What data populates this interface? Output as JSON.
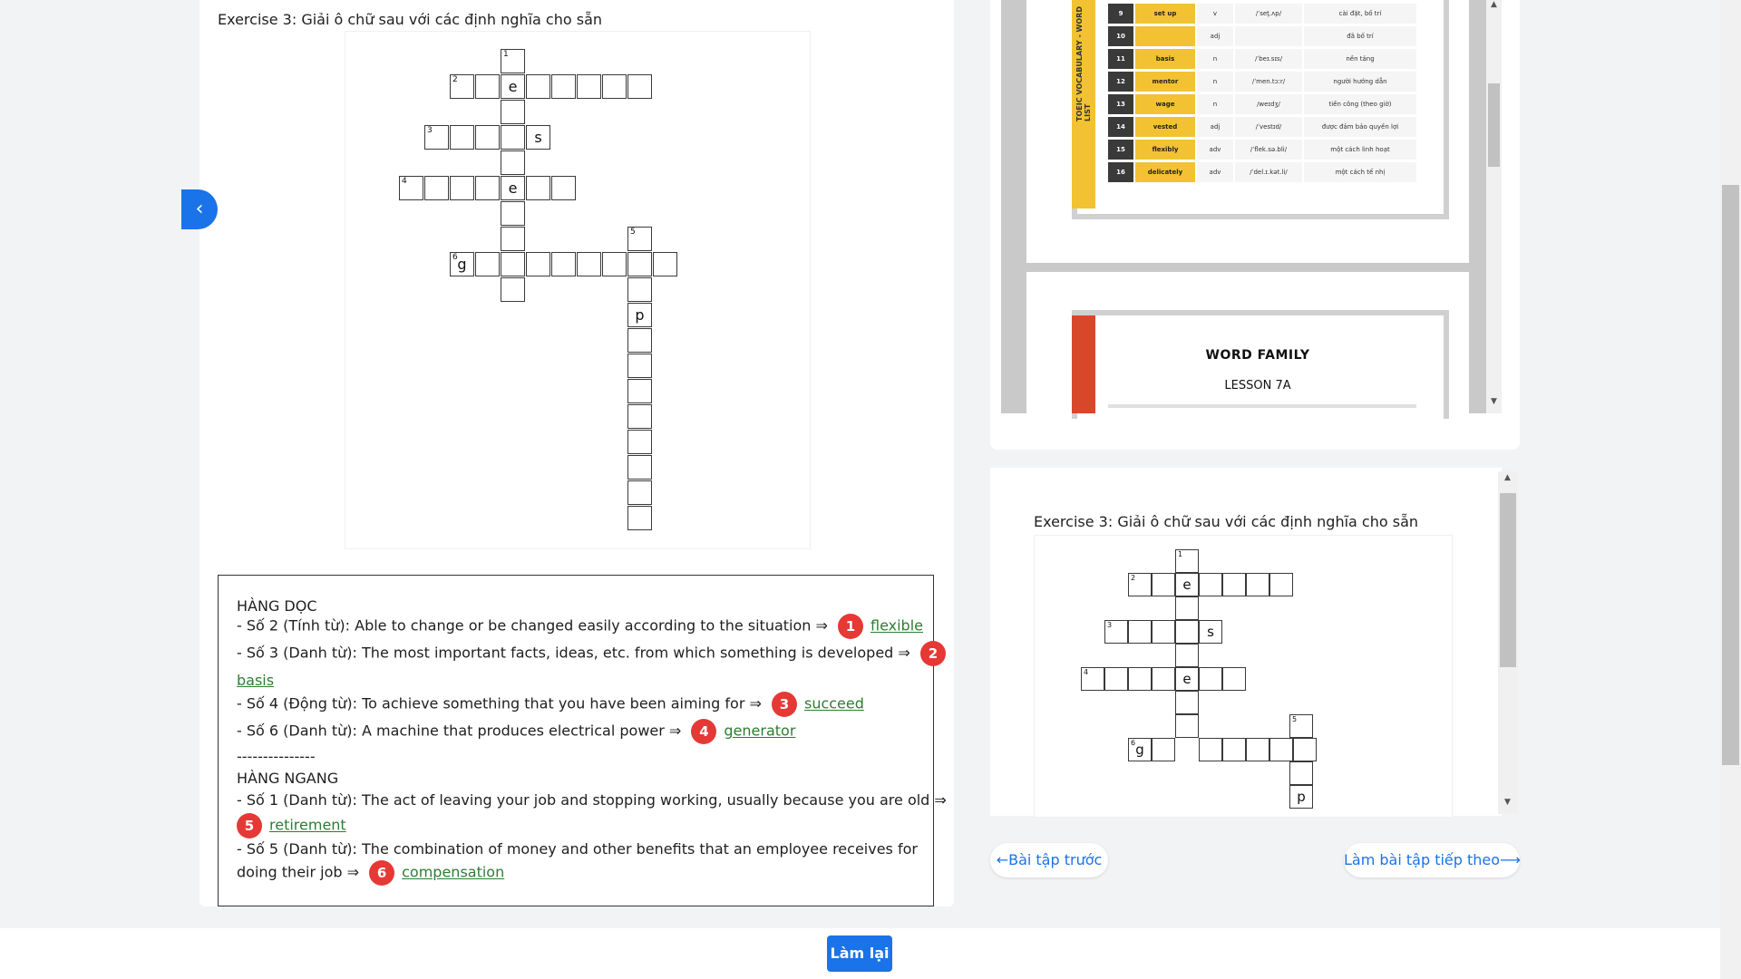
{
  "exercise": {
    "title": "Exercise 3: Giải ô chữ sau với các định nghĩa cho sẵn"
  },
  "crossword": {
    "letters": {
      "l1": "e",
      "l2": "s",
      "l3": "e",
      "l4": "g",
      "l5": "p"
    },
    "numbers": {
      "n1": "1",
      "n2": "2",
      "n3": "3",
      "n4": "4",
      "n5": "5",
      "n6": "6"
    }
  },
  "clues": {
    "vertical_heading": "HÀNG DỌC",
    "v1_text": "- Số 2 (Tính từ): Able to change or be changed easily according to the situation ⇒",
    "v1_badge": "1",
    "v1_answer": "flexible",
    "v2_text": "- Số 3 (Danh từ): The most important facts, ideas, etc. from which something is developed ⇒",
    "v2_badge": "2",
    "v2_answer": "basis",
    "v3_text": "- Số 4 (Động từ): To achieve something that you have been aiming for ⇒",
    "v3_badge": "3",
    "v3_answer": "succeed",
    "v4_text": "- Số 6 (Danh từ): A machine that produces electrical power ⇒",
    "v4_badge": "4",
    "v4_answer": "generator",
    "divider": "---------------",
    "horizontal_heading": "HÀNG NGANG",
    "h1_text": "- Số 1 (Danh từ): The act of leaving your job and stopping working, usually because you are old ⇒",
    "h1_badge": "5",
    "h1_answer": "retirement",
    "h2_text": "- Số 5 (Danh từ): The combination of money and other benefits that an employee receives for",
    "h2_text2": "doing their job ⇒",
    "h2_badge": "6",
    "h2_answer": "compensation"
  },
  "vocab": {
    "side_title": "TOEIC VOCABULARY - WORD LIST",
    "rows": [
      {
        "n": "9",
        "w": "set up",
        "t": "v",
        "p": "/ˈset̬.ʌp/",
        "m": "cài đặt, bố trí"
      },
      {
        "n": "10",
        "w": "",
        "t": "adj",
        "p": "",
        "m": "đã bố trí"
      },
      {
        "n": "11",
        "w": "basis",
        "t": "n",
        "p": "/ˈbeɪ.sɪs/",
        "m": "nền tảng"
      },
      {
        "n": "12",
        "w": "mentor",
        "t": "n",
        "p": "/ˈmen.tɔːr/",
        "m": "người hướng dẫn"
      },
      {
        "n": "13",
        "w": "wage",
        "t": "n",
        "p": "/weɪdʒ/",
        "m": "tiền công (theo giờ)"
      },
      {
        "n": "14",
        "w": "vested",
        "t": "adj",
        "p": "/ˈvestɪd/",
        "m": "được đảm bảo quyền lợi"
      },
      {
        "n": "15",
        "w": "flexibly",
        "t": "adv",
        "p": "/ˈflek.sə.bli/",
        "m": "một cách linh hoạt"
      },
      {
        "n": "16",
        "w": "delicately",
        "t": "adv",
        "p": "/ˈdel.ɪ.kət.li/",
        "m": "một cách tế nhị"
      }
    ]
  },
  "word_family": {
    "title": "WORD FAMILY",
    "subtitle": "LESSON 7A"
  },
  "nav": {
    "prev": "←Bài tập trước",
    "next": "Làm bài tập tiếp theo⟶",
    "redo": "Làm lại",
    "back_icon": "‹"
  },
  "colors": {
    "accent": "#1a73e8",
    "badge": "#e53935",
    "answer": "#2e7d32",
    "yellow": "#f2c232",
    "red_strip": "#d9472b"
  }
}
